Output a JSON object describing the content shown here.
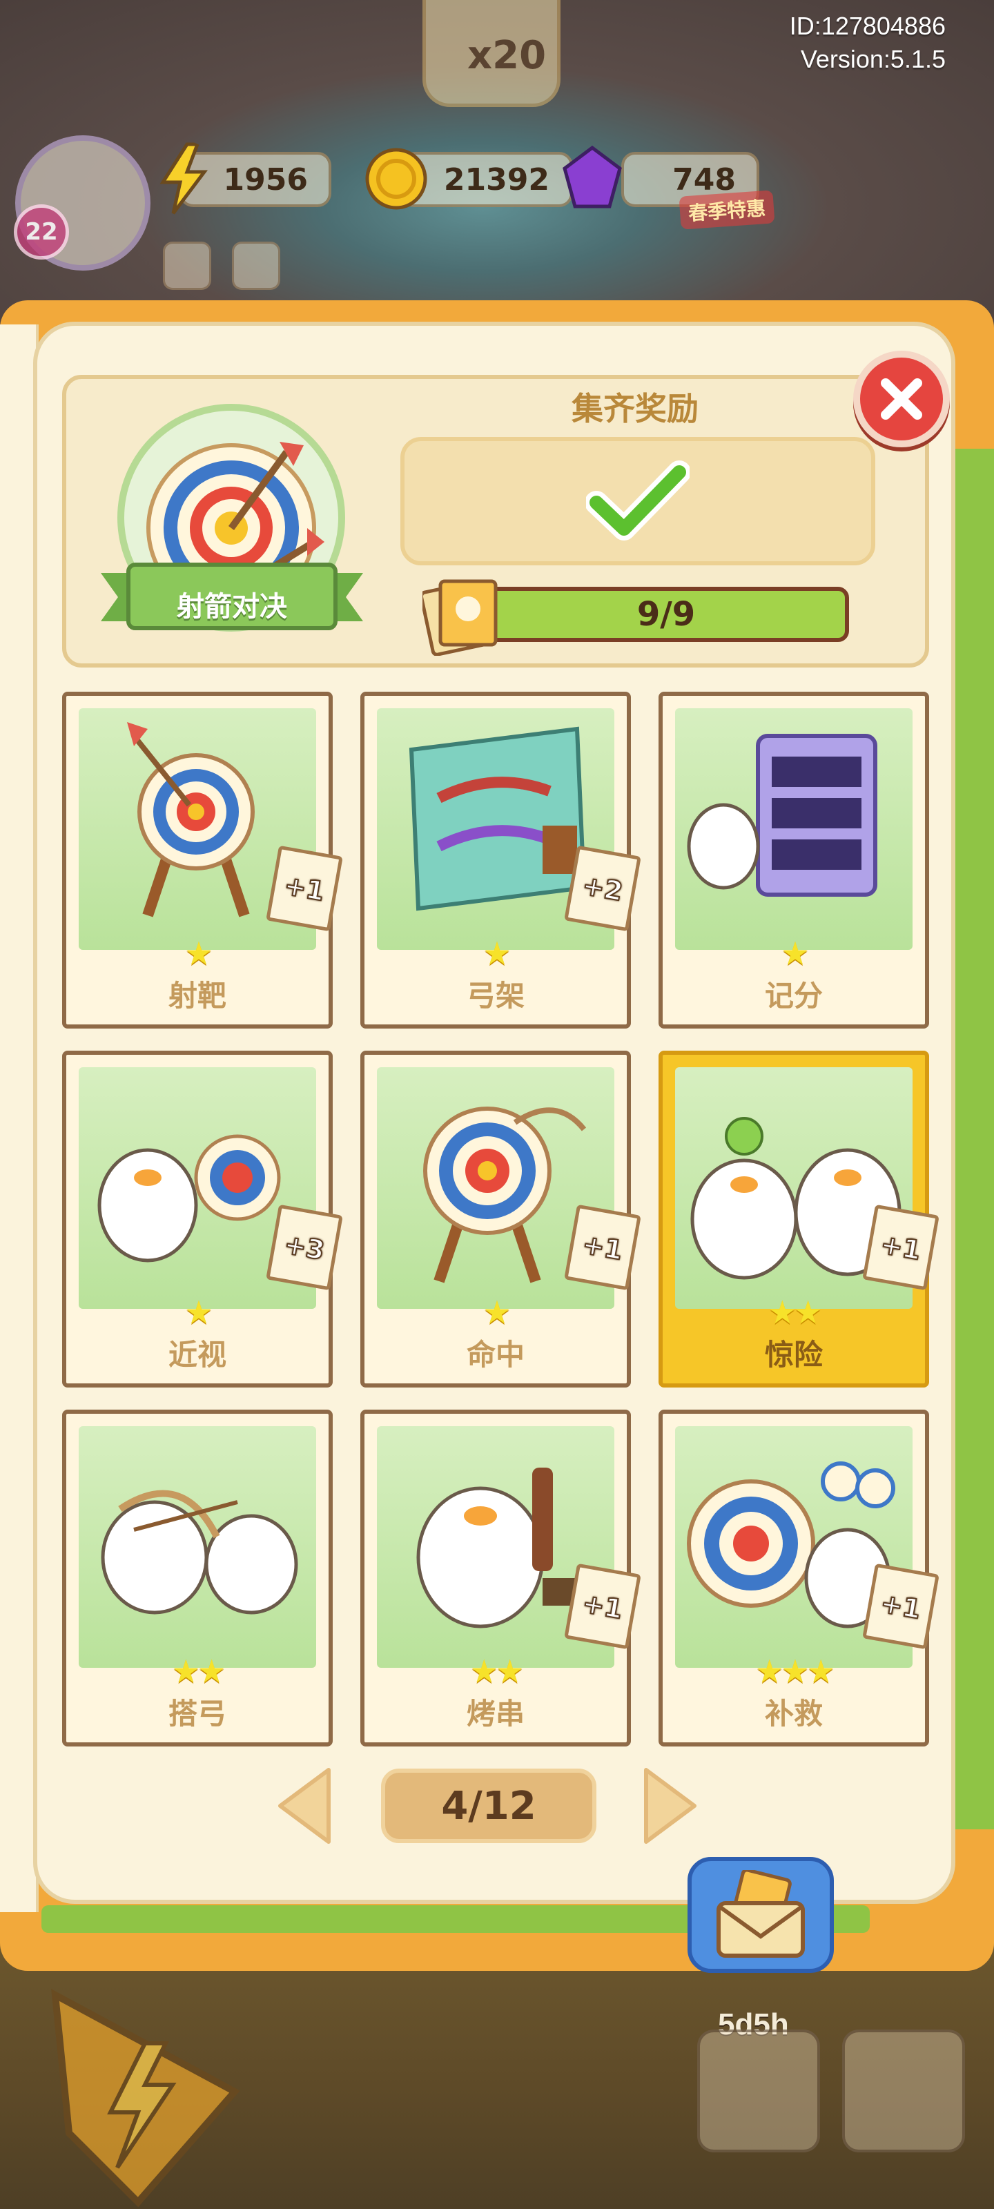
{
  "account": {
    "id_text": "ID:127804886",
    "version_text": "Version:5.1.5"
  },
  "top_badge": "x20",
  "player": {
    "level": "22"
  },
  "resources": {
    "energy": "1956",
    "coins": "21392",
    "gems": "748",
    "promo_label": "春季特惠"
  },
  "collection": {
    "name": "射箭对决",
    "reward_title": "集齐奖励",
    "progress_text": "9/9",
    "progress_fraction": 1.0
  },
  "cards": [
    {
      "label": "射靶",
      "stars": "★",
      "plus": "+1",
      "gold": false
    },
    {
      "label": "弓架",
      "stars": "★",
      "plus": "+2",
      "gold": false
    },
    {
      "label": "记分",
      "stars": "★",
      "plus": "",
      "gold": false
    },
    {
      "label": "近视",
      "stars": "★",
      "plus": "+3",
      "gold": false
    },
    {
      "label": "命中",
      "stars": "★",
      "plus": "+1",
      "gold": false
    },
    {
      "label": "惊险",
      "stars": "★★",
      "plus": "+1",
      "gold": true
    },
    {
      "label": "搭弓",
      "stars": "★★",
      "plus": "",
      "gold": false
    },
    {
      "label": "烤串",
      "stars": "★★",
      "plus": "+1",
      "gold": false
    },
    {
      "label": "补救",
      "stars": "★★★",
      "plus": "+1",
      "gold": false
    }
  ],
  "pagination": {
    "page_text": "4/12"
  },
  "bottom": {
    "timer": "5d5h"
  },
  "colors": {
    "panel_bg": "#fbf3dc",
    "book_orange": "#f2a93b",
    "progress_green": "#a3d34a",
    "close_red": "#e5453f",
    "card_gold": "#f6c628",
    "check_green": "#5cc02f"
  }
}
